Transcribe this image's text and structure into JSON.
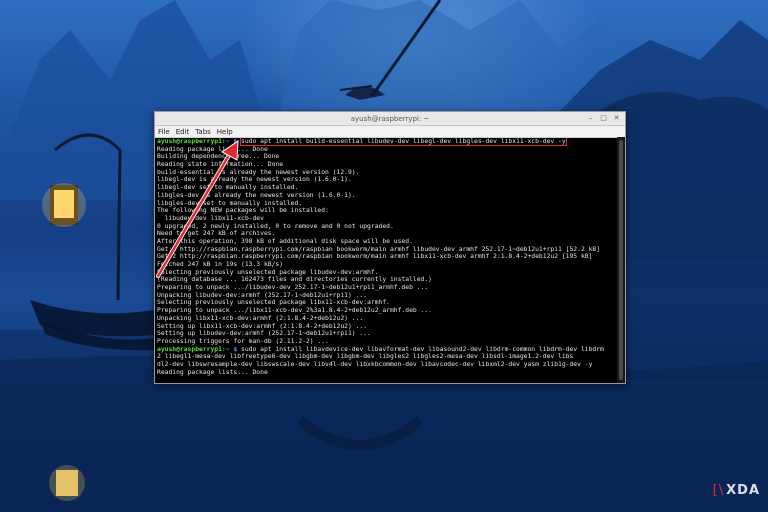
{
  "window": {
    "title": "ayush@raspberrypi: ~",
    "controls": {
      "minimize": "–",
      "maximize": "□",
      "close": "✕"
    }
  },
  "menu": [
    "File",
    "Edit",
    "Tabs",
    "Help"
  ],
  "terminal": {
    "prompt_user": "ayush@raspberrypi:",
    "prompt_path": "~ $",
    "highlighted_command": "sudo apt install build-essential libudev-dev libegl-dev libgles-dev libx11-xcb-dev -y",
    "output_lines": [
      "Reading package lists... Done",
      "Building dependency tree... Done",
      "Reading state information... Done",
      "build-essential is already the newest version (12.9).",
      "libegl-dev is already the newest version (1.6.0-1).",
      "libegl-dev set to manually installed.",
      "libgles-dev is already the newest version (1.6.0-1).",
      "libgles-dev set to manually installed.",
      "The following NEW packages will be installed:",
      "  libudev-dev libx11-xcb-dev",
      "0 upgraded, 2 newly installed, 0 to remove and 0 not upgraded.",
      "Need to get 247 kB of archives.",
      "After this operation, 398 kB of additional disk space will be used.",
      "Get:1 http://raspbian.raspberrypi.com/raspbian bookworm/main armhf libudev-dev armhf 252.17-1~deb12u1+rpi1 [52.2 kB]",
      "Get:2 http://raspbian.raspberrypi.com/raspbian bookworm/main armhf libx11-xcb-dev armhf 2:1.8.4-2+deb12u2 [195 kB]",
      "Fetched 247 kB in 19s (13.3 kB/s)",
      "Selecting previously unselected package libudev-dev:armhf.",
      "(Reading database ... 162473 files and directories currently installed.)",
      "Preparing to unpack .../libudev-dev_252.17-1~deb12u1+rpi1_armhf.deb ...",
      "Unpacking libudev-dev:armhf (252.17-1~deb12u1+rpi1) ...",
      "Selecting previously unselected package libx11-xcb-dev:armhf.",
      "Preparing to unpack .../libx11-xcb-dev_2%3a1.8.4-2+deb12u2_armhf.deb ...",
      "Unpacking libx11-xcb-dev:armhf (2:1.8.4-2+deb12u2) ...",
      "Setting up libx11-xcb-dev:armhf (2:1.8.4-2+deb12u2) ...",
      "Setting up libudev-dev:armhf (252.17-1~deb12u1+rpi1) ...",
      "Processing triggers for man-db (2.11.2-2) ..."
    ],
    "second_command": "sudo apt install libavdevice-dev libavformat-dev libasound2-dev libdrm-common libdrm-dev libdrm",
    "wrap_lines": [
      "2 libegl1-mesa-dev libfreetype6-dev libgbm-dev libgbm-dev libgles2 libgles2-mesa-dev libsdl-image1.2-dev libs",
      "dl2-dev libswresample-dev libswscale-dev libv4l-dev libxkbcommon-dev libavcodec-dev libxml2-dev yasm zlib1g-dev -y",
      "Reading package lists... Done"
    ]
  },
  "logo": {
    "bracket": "[\\",
    "text": "XDA"
  },
  "colors": {
    "prompt_green": "#5fdf3a",
    "path_blue": "#6f8fff",
    "annotation_red": "#e2282f"
  }
}
